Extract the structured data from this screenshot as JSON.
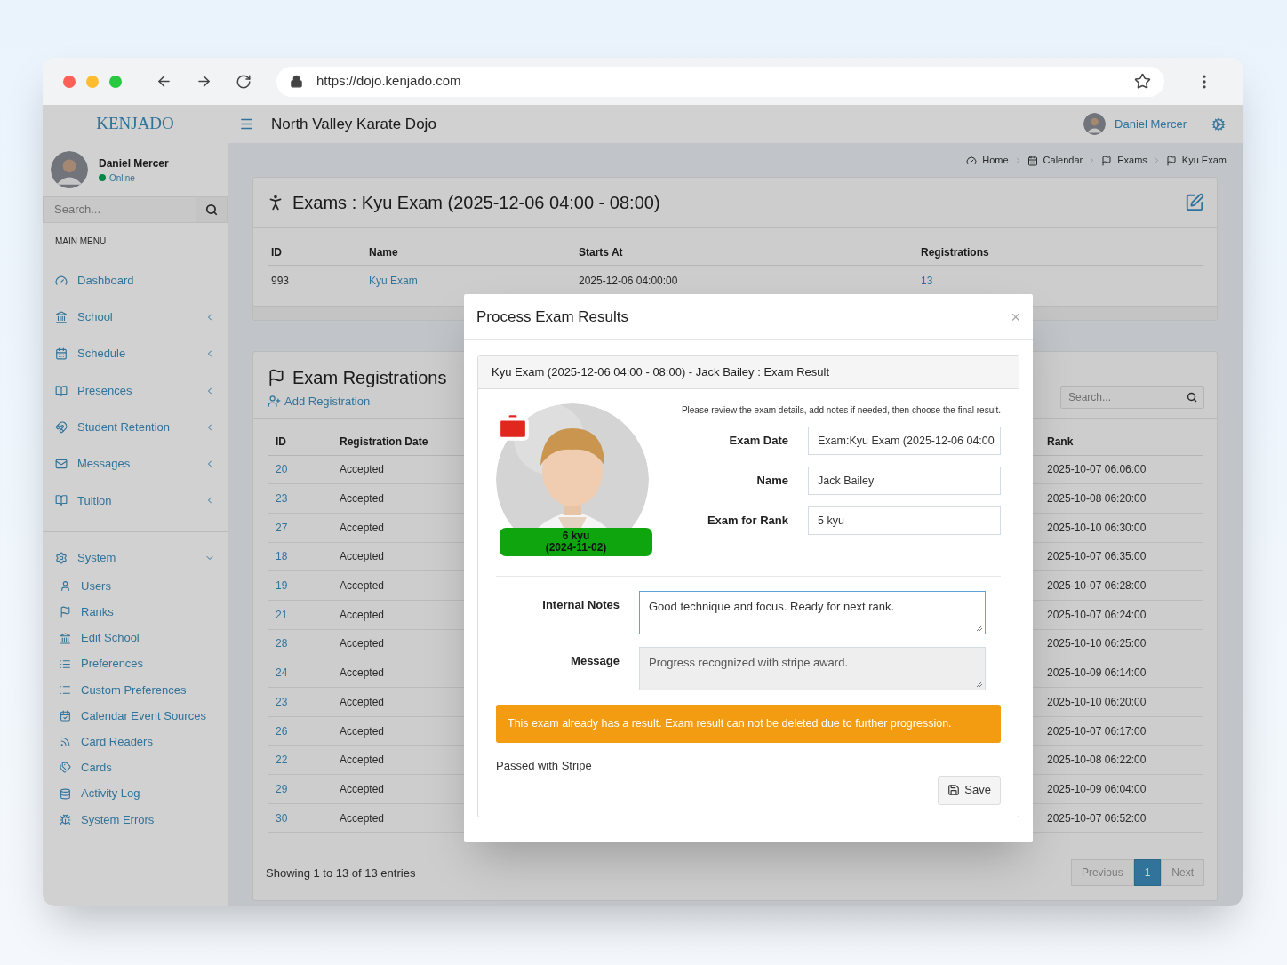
{
  "browser": {
    "url": "https://dojo.kenjado.com"
  },
  "topbar": {
    "brand": "KENJADO",
    "title": "North Valley Karate Dojo",
    "user_name": "Daniel Mercer"
  },
  "sidebar": {
    "user": {
      "name": "Daniel Mercer",
      "status": "Online"
    },
    "search": {
      "placeholder": "Search..."
    },
    "menu_header": "MAIN MENU",
    "menu": [
      {
        "label": "Dashboard",
        "kind": "link"
      },
      {
        "label": "School",
        "kind": "group",
        "expanded": false
      },
      {
        "label": "Schedule",
        "kind": "group",
        "expanded": false
      },
      {
        "label": "Presences",
        "kind": "group",
        "expanded": false
      },
      {
        "label": "Student Retention",
        "kind": "group",
        "expanded": false
      },
      {
        "label": "Messages",
        "kind": "group",
        "expanded": false
      },
      {
        "label": "Tuition",
        "kind": "group",
        "expanded": false
      }
    ],
    "system_menu": {
      "label": "System",
      "expanded": true,
      "children": [
        "Users",
        "Ranks",
        "Edit School",
        "Preferences",
        "Custom Preferences",
        "Calendar Event Sources",
        "Card Readers",
        "Cards",
        "Activity Log",
        "System Errors"
      ]
    }
  },
  "breadcrumb": [
    "Home",
    "Calendar",
    "Exams",
    "Kyu Exam"
  ],
  "exam_panel": {
    "title": "Exams : Kyu Exam (2025-12-06 04:00 - 08:00)",
    "columns": [
      "ID",
      "Name",
      "Starts At",
      "Registrations"
    ],
    "rows": [
      {
        "id": "993",
        "name": "Kyu Exam",
        "starts_at": "2025-12-06 04:00:00",
        "registrations": "13"
      }
    ]
  },
  "registrations_panel": {
    "title": "Exam Registrations",
    "add_link": "Add Registration",
    "search": {
      "placeholder": "Search..."
    },
    "columns": [
      "ID",
      "Registration Date",
      "Rank"
    ],
    "rows": [
      {
        "id": "20",
        "column_2": "Accepted",
        "rank": "2025-10-07 06:06:00"
      },
      {
        "id": "23",
        "column_2": "Accepted",
        "rank": "2025-10-08 06:20:00"
      },
      {
        "id": "27",
        "column_2": "Accepted",
        "rank": "2025-10-10 06:30:00"
      },
      {
        "id": "18",
        "column_2": "Accepted",
        "rank": "2025-10-07 06:35:00"
      },
      {
        "id": "19",
        "column_2": "Accepted",
        "rank": "2025-10-07 06:28:00"
      },
      {
        "id": "21",
        "column_2": "Accepted",
        "rank": "2025-10-07 06:24:00"
      },
      {
        "id": "28",
        "column_2": "Accepted",
        "rank": "2025-10-10 06:25:00"
      },
      {
        "id": "24",
        "column_2": "Accepted",
        "rank": "2025-10-09 06:14:00"
      },
      {
        "id": "23",
        "column_2": "Accepted",
        "rank": "2025-10-10 06:20:00"
      },
      {
        "id": "26",
        "column_2": "Accepted",
        "rank": "2025-10-07 06:17:00"
      },
      {
        "id": "22",
        "column_2": "Accepted",
        "rank": "2025-10-08 06:22:00"
      },
      {
        "id": "29",
        "column_2": "Accepted",
        "rank": "2025-10-09 06:04:00"
      },
      {
        "id": "30",
        "column_2": "Accepted",
        "rank": "2025-10-07 06:52:00"
      }
    ],
    "info": "Showing 1 to 13 of 13 entries",
    "pagination": [
      {
        "label": "Previous",
        "selected": false,
        "disabled": true
      },
      {
        "label": "1",
        "selected": true,
        "disabled": false
      },
      {
        "label": "Next",
        "selected": false,
        "disabled": true
      }
    ]
  },
  "modal": {
    "title": "Process Exam Results",
    "close": "×",
    "panel_title": "Kyu Exam (2025-12-06 04:00 - 08:00) - Jack Bailey : Exam Result",
    "rank_badge": [
      "6 kyu",
      "(2024-11-02)"
    ],
    "instructions": "Please review the exam details, add notes if needed, then choose the final result.",
    "fields": [
      {
        "label": "Exam Date",
        "value": "Exam:Kyu Exam (2025-12-06 04:00"
      },
      {
        "label": "Name",
        "value": "Jack Bailey"
      },
      {
        "label": "Exam for Rank",
        "value": "5 kyu"
      }
    ],
    "notes": {
      "label": "Internal Notes",
      "value": "Good technique and focus. Ready for next rank.",
      "focused": true
    },
    "message": {
      "label": "Message",
      "value": "Progress recognized with stripe award.",
      "disabled": true
    },
    "alert": "This exam already has a result. Exam result can not be deleted due to further progression.",
    "result": "Passed with Stripe",
    "save": "Save"
  }
}
